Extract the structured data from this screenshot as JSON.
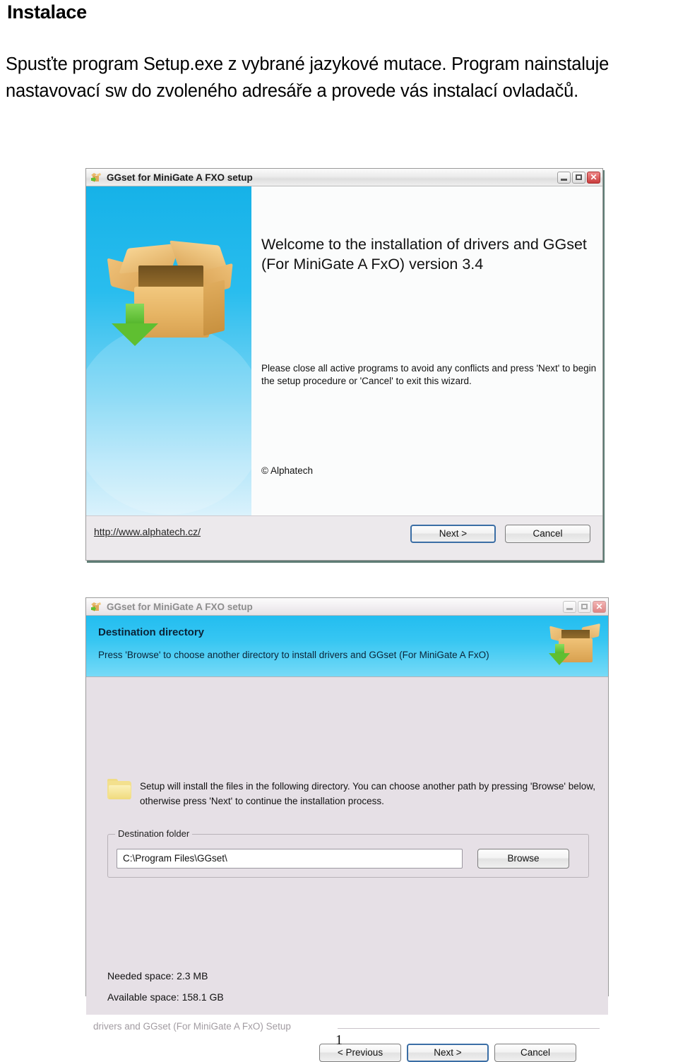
{
  "document": {
    "heading": "Instalace",
    "paragraph": "Spusťte program Setup.exe z vybrané jazykové mutace. Program nainstaluje nastavovací sw do zvoleného adresáře a provede vás  instalací ovladačů.",
    "page_number": "1"
  },
  "welcome_dialog": {
    "title": "GGset for MiniGate A FXO setup",
    "app_icon": "setup-box-icon",
    "window_buttons": {
      "minimize": "minimize-icon",
      "maximize": "maximize-icon",
      "close": "close-icon",
      "close_glyph": "✕"
    },
    "banner_art": "cardboard-box-with-green-arrow",
    "welcome_text": "Welcome to the installation of drivers and GGset (For MiniGate A FxO) version 3.4",
    "note_text": "Please close all active programs to avoid any conflicts and press 'Next' to begin the setup procedure or 'Cancel' to exit this wizard.",
    "copyright": "© Alphatech",
    "link": "http://www.alphatech.cz/",
    "buttons": {
      "next": "Next >",
      "cancel": "Cancel"
    }
  },
  "destination_dialog": {
    "title": "GGset for MiniGate A FXO setup",
    "app_icon": "setup-box-icon",
    "window_buttons": {
      "minimize": "minimize-icon",
      "maximize": "maximize-icon",
      "close": "close-icon",
      "close_glyph": "✕"
    },
    "header": {
      "title": "Destination directory",
      "subtitle": "Press 'Browse' to choose another directory to install drivers and GGset (For MiniGate A FxO)",
      "icon": "setup-box-icon"
    },
    "body_text": "Setup will install the files in the following directory. You can choose another path by pressing 'Browse' below, otherwise press 'Next' to continue the installation process.",
    "folder_icon": "folder-icon",
    "group": {
      "legend": "Destination folder",
      "path_value": "C:\\Program Files\\GGset\\",
      "browse_label": "Browse"
    },
    "needed_space": "Needed space: 2.3 MB",
    "available_space": "Available space: 158.1 GB",
    "status_text": "drivers and GGset (For MiniGate A FxO) Setup",
    "buttons": {
      "previous": "< Previous",
      "next": "Next >",
      "cancel": "Cancel"
    }
  },
  "colors": {
    "banner_cyan": "#23bdf0",
    "dialog_bg": "#e6e0e6",
    "default_button_border": "#3b6ea5",
    "close_button": "#c93c3c",
    "box_orange": "#e6b464",
    "arrow_green": "#5fbf31"
  }
}
